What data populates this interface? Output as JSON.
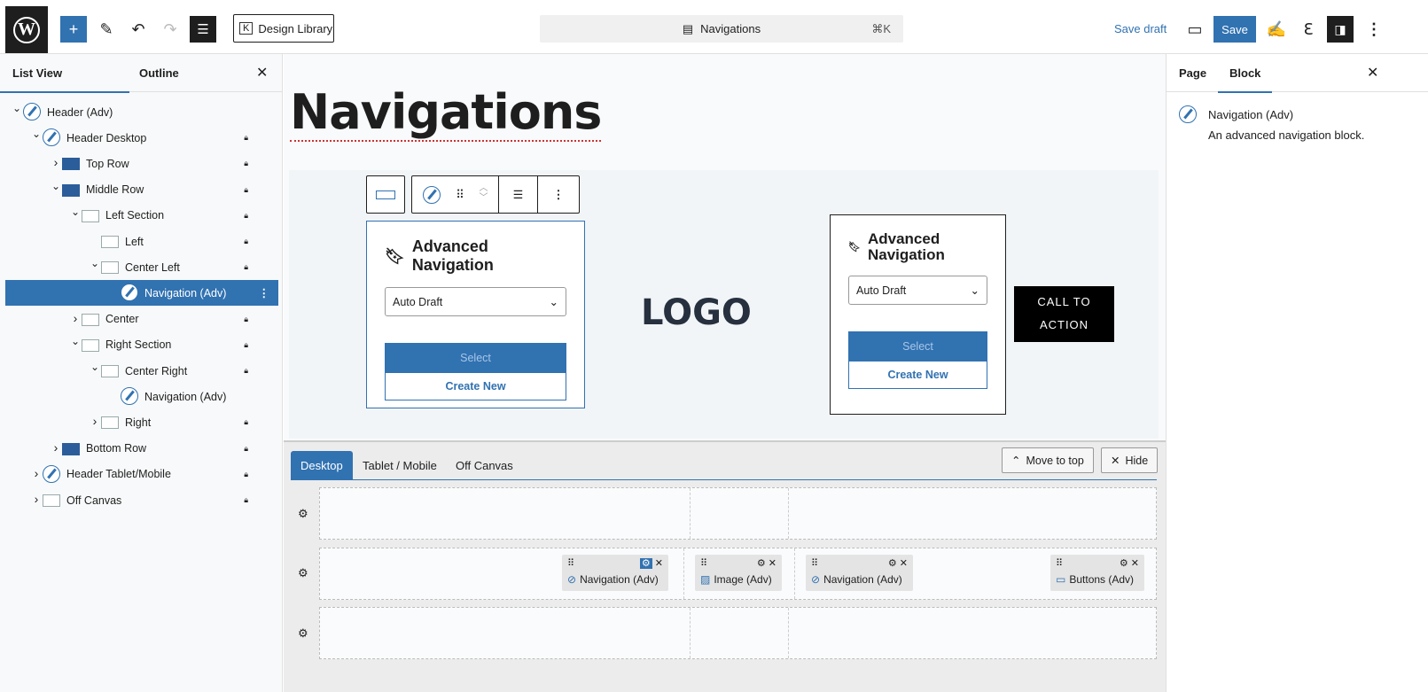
{
  "topbar": {
    "design_library": "Design Library",
    "command_title": "Navigations",
    "command_shortcut": "⌘K",
    "save_draft": "Save draft",
    "save": "Save"
  },
  "left": {
    "tabs": [
      "List View",
      "Outline"
    ],
    "items": [
      {
        "label": "Header (Adv)",
        "level": 0,
        "chev": "open",
        "icon": "nav",
        "lock": false
      },
      {
        "label": "Header Desktop",
        "level": 1,
        "chev": "open",
        "icon": "nav",
        "lock": true
      },
      {
        "label": "Top Row",
        "level": 2,
        "chev": "closed",
        "icon": "blue",
        "lock": true
      },
      {
        "label": "Middle Row",
        "level": 2,
        "chev": "open",
        "icon": "blue",
        "lock": true
      },
      {
        "label": "Left Section",
        "level": 3,
        "chev": "open",
        "icon": "sec",
        "lock": true
      },
      {
        "label": "Left",
        "level": 4,
        "chev": "none",
        "icon": "sec",
        "lock": true
      },
      {
        "label": "Center Left",
        "level": 4,
        "chev": "open",
        "icon": "sec",
        "lock": true
      },
      {
        "label": "Navigation (Adv)",
        "level": 5,
        "chev": "none",
        "icon": "nav",
        "lock": false,
        "selected": true
      },
      {
        "label": "Center",
        "level": 3,
        "chev": "closed",
        "icon": "sec",
        "lock": true
      },
      {
        "label": "Right Section",
        "level": 3,
        "chev": "open",
        "icon": "sec",
        "lock": true
      },
      {
        "label": "Center Right",
        "level": 4,
        "chev": "open",
        "icon": "sec",
        "lock": true
      },
      {
        "label": "Navigation (Adv)",
        "level": 5,
        "chev": "none",
        "icon": "nav",
        "lock": false
      },
      {
        "label": "Right",
        "level": 4,
        "chev": "closed",
        "icon": "sec",
        "lock": true
      },
      {
        "label": "Bottom Row",
        "level": 2,
        "chev": "closed",
        "icon": "blue",
        "lock": true
      },
      {
        "label": "Header Tablet/Mobile",
        "level": 1,
        "chev": "closed",
        "icon": "nav",
        "lock": true
      },
      {
        "label": "Off Canvas",
        "level": 1,
        "chev": "closed",
        "icon": "sec",
        "lock": true
      }
    ]
  },
  "canvas": {
    "title": "Navigations",
    "logo": "LOGO",
    "cta": "CALL TO ACTION",
    "nav_card": {
      "title": "Advanced Navigation",
      "select_value": "Auto Draft",
      "select_btn": "Select",
      "create_btn": "Create New"
    }
  },
  "right": {
    "tabs": [
      "Page",
      "Block"
    ],
    "block_name": "Navigation (Adv)",
    "block_desc": "An advanced navigation block."
  },
  "builder": {
    "tabs": [
      "Desktop",
      "Tablet / Mobile",
      "Off Canvas"
    ],
    "move_to_top": "Move to top",
    "hide": "Hide",
    "chips": [
      "Navigation (Adv)",
      "Image (Adv)",
      "Navigation (Adv)",
      "Buttons (Adv)"
    ]
  },
  "colors": {
    "accent": "#3172b1"
  }
}
